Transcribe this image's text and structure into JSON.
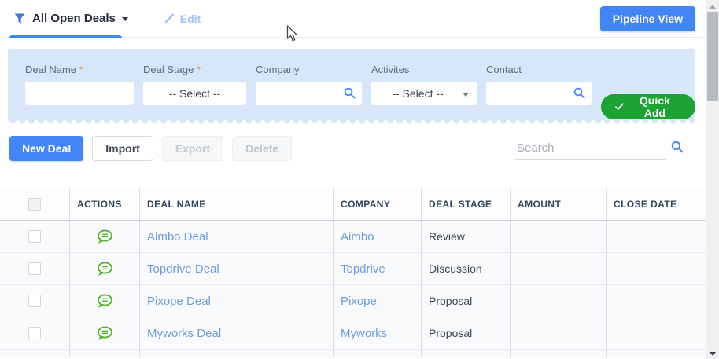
{
  "header": {
    "filter_view_label": "All Open Deals",
    "edit_label": "Edit",
    "pipeline_view_label": "Pipeline View"
  },
  "quick_add_panel": {
    "fields": [
      {
        "label": "Deal Name",
        "required_mark": " *",
        "value": ""
      },
      {
        "label": "Deal Stage",
        "required_mark": " *",
        "value": "-- Select --"
      },
      {
        "label": "Company",
        "required_mark": "",
        "value": ""
      },
      {
        "label": "Activites",
        "required_mark": "",
        "value": "-- Select --"
      },
      {
        "label": "Contact",
        "required_mark": "",
        "value": ""
      }
    ],
    "quick_add_label": "Quick Add"
  },
  "toolbar": {
    "new_deal_label": "New Deal",
    "import_label": "Import",
    "export_label": "Export",
    "delete_label": "Delete",
    "search_placeholder": "Search"
  },
  "table": {
    "columns": [
      "ACTIONS",
      "DEAL NAME",
      "COMPANY",
      "DEAL STAGE",
      "AMOUNT",
      "CLOSE DATE"
    ],
    "rows": [
      {
        "deal_name": "Aimbo Deal",
        "company": "Aimbo",
        "deal_stage": "Review",
        "amount": "",
        "close_date": ""
      },
      {
        "deal_name": "Topdrive Deal",
        "company": "Topdrive",
        "deal_stage": "Discussion",
        "amount": "",
        "close_date": ""
      },
      {
        "deal_name": "Pixope Deal",
        "company": "Pixope",
        "deal_stage": "Proposal",
        "amount": "",
        "close_date": ""
      },
      {
        "deal_name": "Myworks Deal",
        "company": "Myworks",
        "deal_stage": "Proposal",
        "amount": "",
        "close_date": ""
      }
    ]
  },
  "icons": {
    "filter": "funnel-icon",
    "edit": "pencil-icon",
    "search": "magnifier-icon",
    "quick_add_check": "check-icon",
    "row_action": "comment-bubble-icon",
    "caret": "caret-down-icon"
  },
  "colors": {
    "accent_blue": "#4285f4",
    "panel_blue": "#d8e6fa",
    "success_green": "#1da334",
    "link_blue": "#6d9be1",
    "icon_green": "#56b22a",
    "header_text": "#33475b",
    "required_orange": "#e2944c"
  }
}
